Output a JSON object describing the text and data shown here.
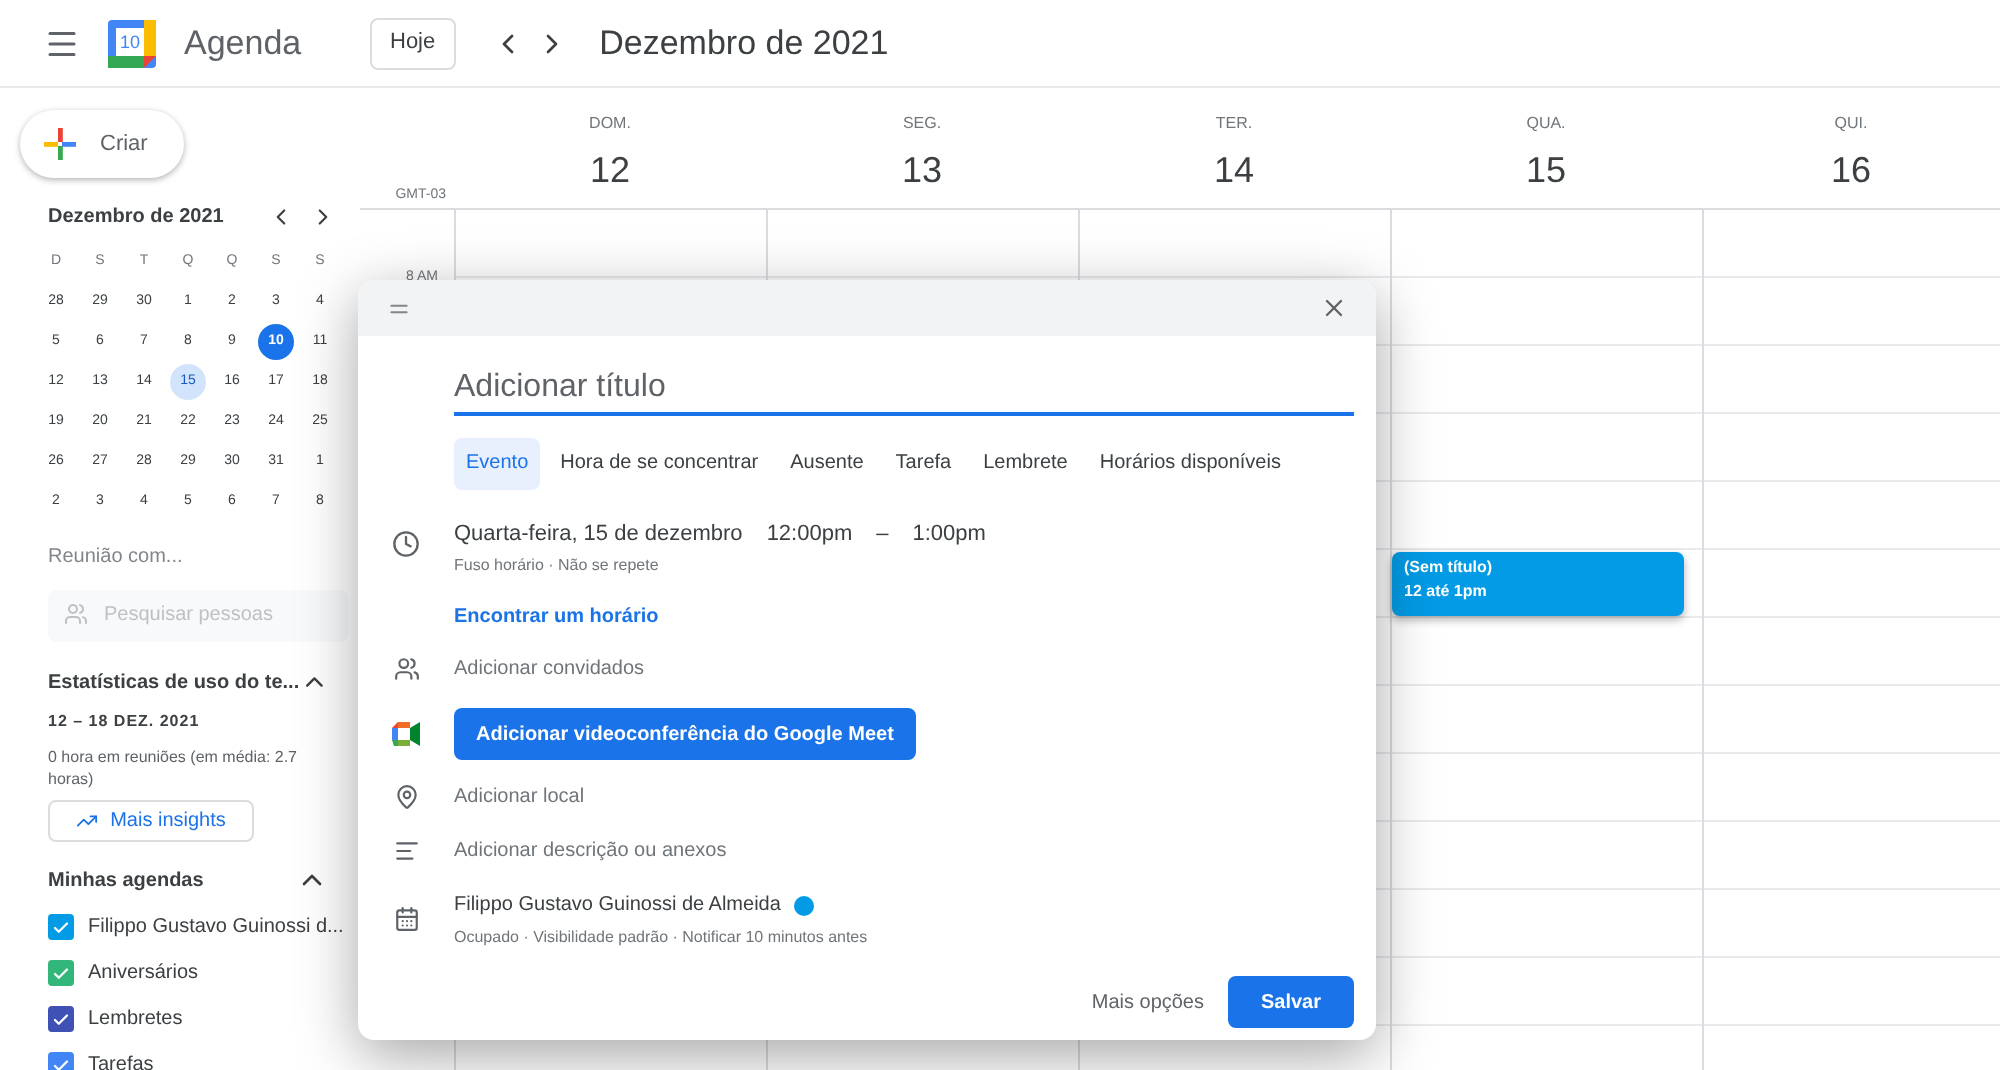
{
  "header": {
    "app_name": "Agenda",
    "logo_day": "10",
    "today_button": "Hoje",
    "title": "Dezembro de 2021"
  },
  "create_button": "Criar",
  "mini_calendar": {
    "title": "Dezembro de 2021",
    "weekdays": [
      "D",
      "S",
      "T",
      "Q",
      "Q",
      "S",
      "S"
    ],
    "weeks": [
      [
        {
          "day": "28",
          "today": false,
          "selected": false
        },
        {
          "day": "29",
          "today": false,
          "selected": false
        },
        {
          "day": "30",
          "today": false,
          "selected": false
        },
        {
          "day": "1",
          "today": false,
          "selected": false
        },
        {
          "day": "2",
          "today": false,
          "selected": false
        },
        {
          "day": "3",
          "today": false,
          "selected": false
        },
        {
          "day": "4",
          "today": false,
          "selected": false
        }
      ],
      [
        {
          "day": "5",
          "today": false,
          "selected": false
        },
        {
          "day": "6",
          "today": false,
          "selected": false
        },
        {
          "day": "7",
          "today": false,
          "selected": false
        },
        {
          "day": "8",
          "today": false,
          "selected": false
        },
        {
          "day": "9",
          "today": false,
          "selected": false
        },
        {
          "day": "10",
          "today": true,
          "selected": false
        },
        {
          "day": "11",
          "today": false,
          "selected": false
        }
      ],
      [
        {
          "day": "12",
          "today": false,
          "selected": false
        },
        {
          "day": "13",
          "today": false,
          "selected": false
        },
        {
          "day": "14",
          "today": false,
          "selected": false
        },
        {
          "day": "15",
          "today": false,
          "selected": true
        },
        {
          "day": "16",
          "today": false,
          "selected": false
        },
        {
          "day": "17",
          "today": false,
          "selected": false
        },
        {
          "day": "18",
          "today": false,
          "selected": false
        }
      ],
      [
        {
          "day": "19",
          "today": false,
          "selected": false
        },
        {
          "day": "20",
          "today": false,
          "selected": false
        },
        {
          "day": "21",
          "today": false,
          "selected": false
        },
        {
          "day": "22",
          "today": false,
          "selected": false
        },
        {
          "day": "23",
          "today": false,
          "selected": false
        },
        {
          "day": "24",
          "today": false,
          "selected": false
        },
        {
          "day": "25",
          "today": false,
          "selected": false
        }
      ],
      [
        {
          "day": "26",
          "today": false,
          "selected": false
        },
        {
          "day": "27",
          "today": false,
          "selected": false
        },
        {
          "day": "28",
          "today": false,
          "selected": false
        },
        {
          "day": "29",
          "today": false,
          "selected": false
        },
        {
          "day": "30",
          "today": false,
          "selected": false
        },
        {
          "day": "31",
          "today": false,
          "selected": false
        },
        {
          "day": "1",
          "today": false,
          "selected": false
        }
      ],
      [
        {
          "day": "2",
          "today": false,
          "selected": false
        },
        {
          "day": "3",
          "today": false,
          "selected": false
        },
        {
          "day": "4",
          "today": false,
          "selected": false
        },
        {
          "day": "5",
          "today": false,
          "selected": false
        },
        {
          "day": "6",
          "today": false,
          "selected": false
        },
        {
          "day": "7",
          "today": false,
          "selected": false
        },
        {
          "day": "8",
          "today": false,
          "selected": false
        }
      ]
    ]
  },
  "meet_with": {
    "label": "Reunião com...",
    "search_placeholder": "Pesquisar pessoas"
  },
  "stats": {
    "title": "Estatísticas de uso do te...",
    "expanded": true,
    "range": "12 – 18 DEZ. 2021",
    "summary": "0 hora em reuniões (em média: 2.7 horas)",
    "button": "Mais insights"
  },
  "my_calendars": {
    "title": "Minhas agendas",
    "expanded": true,
    "items": [
      {
        "name": "Filippo Gustavo Guinossi d...",
        "checked": true,
        "color": "#039be5"
      },
      {
        "name": "Aniversários",
        "checked": true,
        "color": "#33b679"
      },
      {
        "name": "Lembretes",
        "checked": true,
        "color": "#3f51b5"
      },
      {
        "name": "Tarefas",
        "checked": true,
        "color": "#4285f4"
      }
    ]
  },
  "week": {
    "timezone": "GMT-03",
    "hours": [
      "8 AM"
    ],
    "days": [
      {
        "weekday": "DOM.",
        "date": "12"
      },
      {
        "weekday": "SEG.",
        "date": "13"
      },
      {
        "weekday": "TER.",
        "date": "14"
      },
      {
        "weekday": "QUA.",
        "date": "15"
      },
      {
        "weekday": "QUI.",
        "date": "16"
      }
    ]
  },
  "event": {
    "title": "(Sem título)",
    "time": "12 até 1pm",
    "color": "#039be5"
  },
  "dialog": {
    "title_placeholder": "Adicionar título",
    "tabs": [
      {
        "label": "Evento",
        "selected": true
      },
      {
        "label": "Hora de se concentrar",
        "selected": false
      },
      {
        "label": "Ausente",
        "selected": false
      },
      {
        "label": "Tarefa",
        "selected": false
      },
      {
        "label": "Lembrete",
        "selected": false
      },
      {
        "label": "Horários disponíveis",
        "selected": false
      }
    ],
    "date": "Quarta-feira, 15 de dezembro",
    "start": "12:00pm",
    "dash": "–",
    "end": "1:00pm",
    "time_details": "Fuso horário · Não se repete",
    "find_time_link": "Encontrar um horário",
    "guests_placeholder": "Adicionar convidados",
    "meet_button": "Adicionar videoconferência do Google Meet",
    "location_placeholder": "Adicionar local",
    "description_placeholder": "Adicionar descrição ou anexos",
    "calendar_owner": "Filippo Gustavo Guinossi de Almeida",
    "calendar_dot": {
      "color": "#039be5"
    },
    "calendar_details": "Ocupado · Visibilidade padrão · Notificar 10 minutos antes",
    "more_options": "Mais opções",
    "save": "Salvar"
  }
}
